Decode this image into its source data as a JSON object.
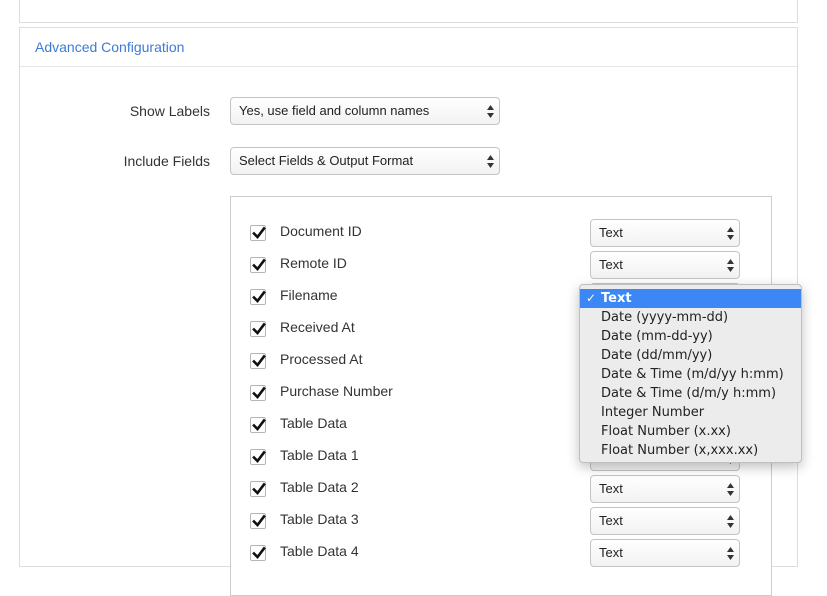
{
  "advanced": {
    "title": "Advanced Configuration",
    "show_labels": {
      "label": "Show Labels",
      "value": "Yes, use field and column names"
    },
    "include_fields": {
      "label": "Include Fields",
      "value": "Select Fields & Output Format"
    }
  },
  "fields": [
    {
      "name": "Document ID",
      "checked": true,
      "format": "Text"
    },
    {
      "name": "Remote ID",
      "checked": true,
      "format": "Text"
    },
    {
      "name": "Filename",
      "checked": true,
      "format": "Text"
    },
    {
      "name": "Received At",
      "checked": true,
      "format": ""
    },
    {
      "name": "Processed At",
      "checked": true,
      "format": ""
    },
    {
      "name": "Purchase Number",
      "checked": true,
      "format": ""
    },
    {
      "name": "Table Data",
      "checked": true,
      "format": ""
    },
    {
      "name": "Table Data 1",
      "checked": true,
      "format": ""
    },
    {
      "name": "Table Data 2",
      "checked": true,
      "format": "Text"
    },
    {
      "name": "Table Data 3",
      "checked": true,
      "format": "Text"
    },
    {
      "name": "Table Data 4",
      "checked": true,
      "format": "Text"
    }
  ],
  "dropdown": {
    "selected": "Text",
    "options": [
      "Text",
      "Date (yyyy-mm-dd)",
      "Date (mm-dd-yy)",
      "Date (dd/mm/yy)",
      "Date & Time (m/d/yy h:mm)",
      "Date & Time (d/m/y h:mm)",
      "Integer Number",
      "Float Number (x.xx)",
      "Float Number (x,xxx.xx)"
    ]
  },
  "colors": {
    "accent_link": "#3c7bd6",
    "highlight": "#3a87f5"
  },
  "icons": {
    "checkbox": "checkmark-icon",
    "select": "updown-arrows-icon",
    "selected_option": "check-icon"
  }
}
